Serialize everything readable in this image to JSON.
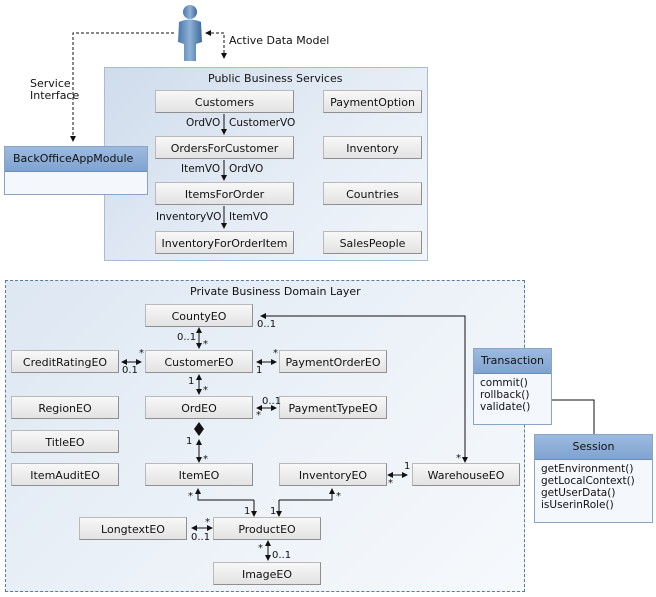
{
  "actor": {
    "label": "Active Data Model",
    "icon": "user-icon"
  },
  "service_interface": {
    "line1": "Service",
    "line2": "Interface"
  },
  "back_office": {
    "title": "BackOfficeAppModule"
  },
  "public_services": {
    "title": "Public Business Services",
    "left_column": [
      "Customers",
      "OrdersForCustomer",
      "ItemsForOrder",
      "InventoryForOrderItem"
    ],
    "right_column": [
      "PaymentOption",
      "Inventory",
      "Countries",
      "SalesPeople"
    ],
    "links": [
      {
        "left": "OrdVO",
        "right": "CustomerVO"
      },
      {
        "left": "ItemVO",
        "right": "OrdVO"
      },
      {
        "left": "InventoryVO",
        "right": "ItemVO"
      }
    ]
  },
  "domain_layer": {
    "title": "Private Business Domain Layer",
    "entities": {
      "county": "CountyEO",
      "credit_rating": "CreditRatingEO",
      "customer": "CustomerEO",
      "payment_order": "PaymentOrderEO",
      "region": "RegionEO",
      "ord": "OrdEO",
      "payment_type": "PaymentTypeEO",
      "title": "TitleEO",
      "item_audit": "ItemAuditEO",
      "item": "ItemEO",
      "inventory": "InventoryEO",
      "warehouse": "WarehouseEO",
      "longtext": "LongtextEO",
      "product": "ProductEO",
      "image": "ImageEO"
    },
    "multiplicities": {
      "county_warehouse_county": "0..1",
      "county_warehouse_warehouse": "*",
      "county_customer_county": "0..1",
      "county_customer_customer": "*",
      "credit_customer_credit": "0.1",
      "credit_customer_customer": "*",
      "customer_payorder_customer": "1",
      "customer_payorder_payorder": "*",
      "customer_ord_customer": "1",
      "customer_ord_ord": "*",
      "ord_paytype_ord": "*",
      "ord_paytype_paytype": "0..1",
      "ord_item_ord": "1",
      "ord_item_item": "*",
      "inventory_warehouse_inventory": "*",
      "inventory_warehouse_warehouse": "1",
      "item_product_item": "*",
      "item_product_product": "1",
      "inventory_product_inventory": "*",
      "inventory_product_product": "1",
      "longtext_product_longtext": "0..1",
      "longtext_product_product": "*",
      "product_image_product": "*",
      "product_image_image": "0..1"
    }
  },
  "transaction": {
    "title": "Transaction",
    "operations": [
      "commit()",
      "rollback()",
      "validate()"
    ]
  },
  "session": {
    "title": "Session",
    "operations": [
      "getEnvironment()",
      "getLocalContext()",
      "getUserData()",
      "isUserinRole()"
    ]
  }
}
